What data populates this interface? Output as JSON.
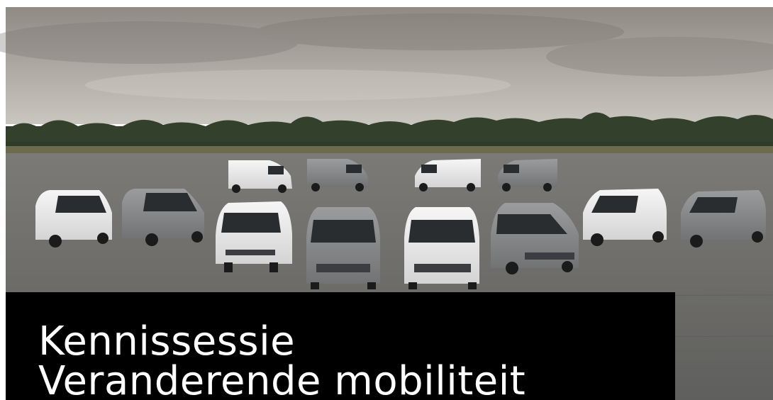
{
  "slide": {
    "title_line_1": "Kennissessie",
    "title_line_2": "Veranderende mobiliteit"
  },
  "photo": {
    "subject": "fleet-of-vans",
    "colors": {
      "sky": "#a9a49e",
      "trees": "#2f3b29",
      "tarmac": "#6f6f6c",
      "van_white": "#ececec",
      "van_grey": "#8a8b8c",
      "panel": "#000000",
      "title": "#ffffff"
    }
  }
}
